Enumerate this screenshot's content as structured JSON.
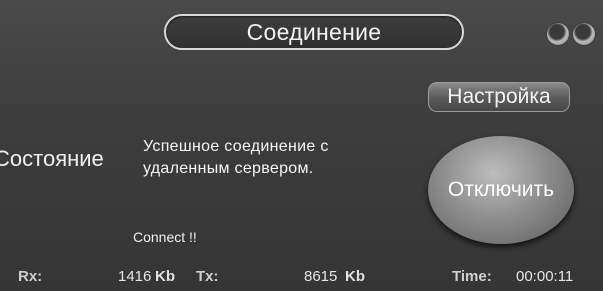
{
  "window": {
    "title": "Соединение",
    "controls": [
      "minimize-icon",
      "close-icon"
    ]
  },
  "actions": {
    "settings_label": "Настройка",
    "disconnect_label": "Отключить"
  },
  "status": {
    "label": "Состояние",
    "message": "Успешное соединение с удаленным сервером.",
    "connect_text": "Connect !!"
  },
  "stats": {
    "rx_label": "Rx:",
    "rx_value": "1416",
    "rx_unit": "Kb",
    "tx_label": "Tx:",
    "tx_value": "8615",
    "tx_unit": "Kb",
    "time_label": "Time:",
    "time_value": "00:00:11"
  },
  "colors": {
    "panel_bg": "#3c3c3c",
    "text": "#f0f0f0",
    "button": "#8e8e8e"
  }
}
